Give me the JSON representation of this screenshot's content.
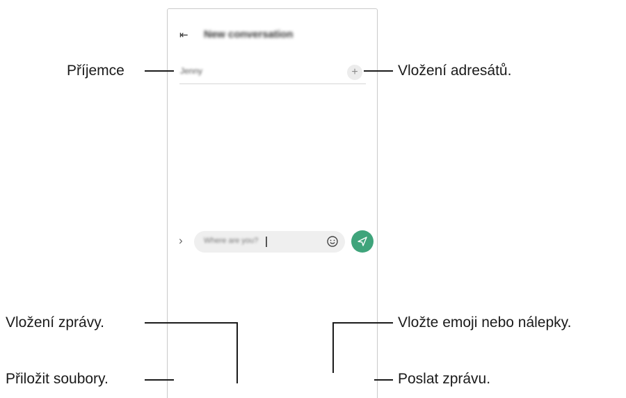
{
  "screen": {
    "title": "New conversation",
    "recipient": "Jenny",
    "message_text": "Where are you?"
  },
  "callouts": {
    "recipient": "Příjemce",
    "add_recipients": "Vložení adresátů.",
    "enter_message": "Vložení zprávy.",
    "emoji": "Vložte emoji nebo nálepky.",
    "attach": "Přiložit soubory.",
    "send": "Poslat zprávu."
  },
  "colors": {
    "send_button": "#3fa47b",
    "frame": "#c9c9c9"
  }
}
